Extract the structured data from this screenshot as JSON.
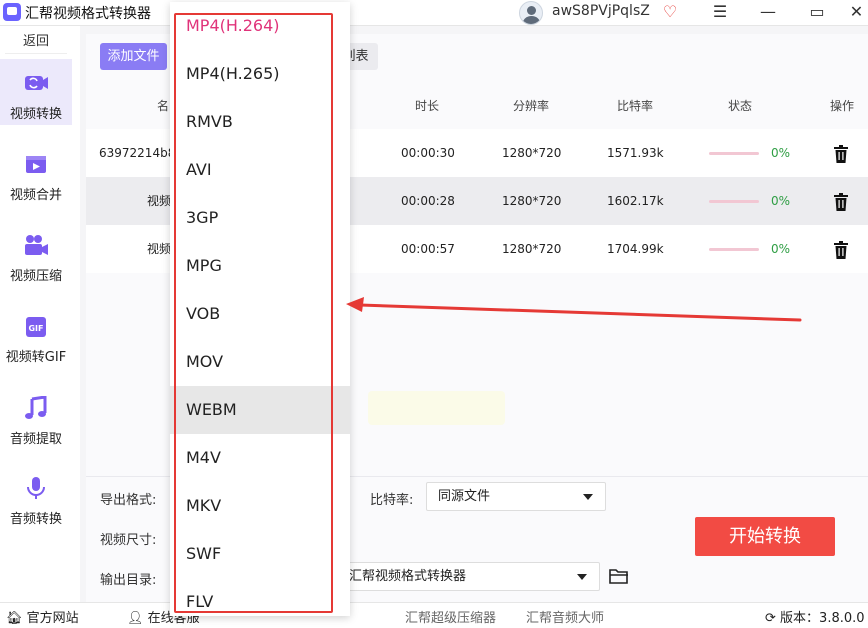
{
  "app": {
    "title": "汇帮视频格式转换器"
  },
  "user": {
    "name": "awS8PVjPqlsZ"
  },
  "sidebar": {
    "back_label": "返回",
    "items": [
      {
        "label": "视频转换",
        "icon": "video-convert-icon",
        "active": true
      },
      {
        "label": "视频合并",
        "icon": "video-merge-icon",
        "active": false
      },
      {
        "label": "视频压缩",
        "icon": "video-compress-icon",
        "active": false
      },
      {
        "label": "视频转GIF",
        "icon": "gif-icon",
        "active": false
      },
      {
        "label": "音频提取",
        "icon": "music-note-icon",
        "active": false
      },
      {
        "label": "音频转换",
        "icon": "microphone-icon",
        "active": false
      }
    ]
  },
  "toolbar": {
    "add_file": "添加文件",
    "list_partial": "列表"
  },
  "table": {
    "headers": {
      "name": "名",
      "duration": "时长",
      "resolution": "分辨率",
      "bitrate": "比特率",
      "status": "状态",
      "action": "操作"
    },
    "rows": [
      {
        "name": "63972214b8",
        "duration": "00:00:30",
        "resolution": "1280*720",
        "bitrate": "1571.93k",
        "progress": "0%"
      },
      {
        "name": "视频",
        "duration": "00:00:28",
        "resolution": "1280*720",
        "bitrate": "1602.17k",
        "progress": "0%"
      },
      {
        "name": "视频",
        "duration": "00:00:57",
        "resolution": "1280*720",
        "bitrate": "1704.99k",
        "progress": "0%"
      }
    ]
  },
  "settings": {
    "format_label": "导出格式:",
    "bitrate_label": "比特率:",
    "bitrate_value": "同源文件",
    "size_label": "视频尺寸:",
    "output_label": "输出目录:",
    "output_value": "汇帮视频格式转换器",
    "start_button": "开始转换"
  },
  "dropdown": {
    "options": [
      "MP4(H.264)",
      "MP4(H.265)",
      "RMVB",
      "AVI",
      "3GP",
      "MPG",
      "VOB",
      "MOV",
      "WEBM",
      "M4V",
      "MKV",
      "SWF",
      "FLV"
    ],
    "selected": "MP4(H.264)",
    "hovered": "WEBM"
  },
  "statusbar": {
    "website": "官方网站",
    "online": "在线客服",
    "link1": "汇帮超级压缩器",
    "link2": "汇帮音频大师",
    "version": "版本：3.8.0.0"
  },
  "colors": {
    "accent": "#8a7cf4",
    "start": "#f24b44",
    "selected_option": "#e0337a",
    "annotation": "#e53935"
  }
}
